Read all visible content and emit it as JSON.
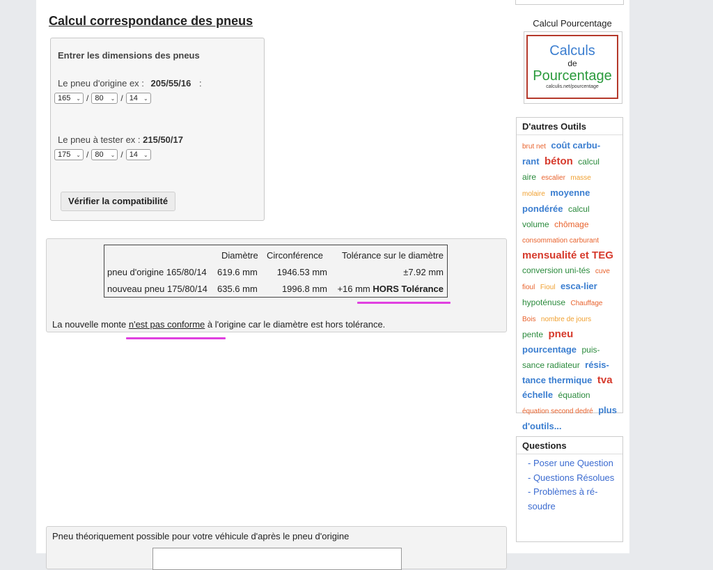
{
  "main": {
    "title": "Calcul correspondance des pneus",
    "form": {
      "heading": "Entrer les dimensions des pneus",
      "origin_label": "Le pneu d'origine ex : ",
      "origin_example": "205/55/16",
      "origin_suffix": ":",
      "origin_width": "165",
      "origin_ratio": "80",
      "origin_rim": "14",
      "test_label": "Le pneu à tester ex : ",
      "test_example": "215/50/17",
      "test_width": "175",
      "test_ratio": "80",
      "test_rim": "14",
      "separator": "/",
      "submit_label": "Vérifier la compatibilité"
    },
    "result": {
      "headers": [
        "Diamètre",
        "Circonférence",
        "Tolérance sur le diamètre"
      ],
      "rows": [
        {
          "label": "pneu d'origine 165/80/14",
          "diameter": "619.6 mm",
          "circumference": "1946.53 mm",
          "tolerance": "±7.92 mm",
          "tolerance_bold": ""
        },
        {
          "label": "nouveau pneu 175/80/14",
          "diameter": "635.6 mm",
          "circumference": "1996.8 mm",
          "tolerance": "+16 mm ",
          "tolerance_bold": "HORS Tolérance"
        }
      ],
      "verdict_before": "La nouvelle monte ",
      "verdict_link": "n'est pas conforme",
      "verdict_after": " à l'origine car le diamètre est hors tolérance."
    },
    "theoretical": {
      "text": "Pneu théoriquement possible pour votre véhicule d'après le pneu d'origine"
    }
  },
  "sidebar": {
    "percent_title": "Calcul Pourcentage",
    "percent_logo": {
      "line1": "Calculs",
      "line2": "de",
      "line3": "Pourcentage",
      "line4": "calculis.net/pourcentage"
    },
    "tools_title": "D'autres Outils",
    "tools": [
      {
        "label": "brut net",
        "color": "#e8622c",
        "size": "s"
      },
      {
        "label": "coût carbu-rant",
        "color": "#3b7ed0",
        "size": "l"
      },
      {
        "label": "béton",
        "color": "#d63a2c",
        "size": "xl"
      },
      {
        "label": "calcul aire",
        "color": "#2a8a3c",
        "size": "m"
      },
      {
        "label": "escalier",
        "color": "#e8622c",
        "size": "s"
      },
      {
        "label": "masse molaire",
        "color": "#f0a030",
        "size": "s"
      },
      {
        "label": "moyenne pondérée",
        "color": "#3b7ed0",
        "size": "l"
      },
      {
        "label": "calcul volume",
        "color": "#2a8a3c",
        "size": "m"
      },
      {
        "label": "chômage",
        "color": "#e8622c",
        "size": "m"
      },
      {
        "label": "consommation carburant",
        "color": "#e8622c",
        "size": "s"
      },
      {
        "label": "mensualité et TEG",
        "color": "#d63a2c",
        "size": "xl"
      },
      {
        "label": "conversion uni-tés",
        "color": "#2a8a3c",
        "size": "m"
      },
      {
        "label": "cuve fioul",
        "color": "#e8622c",
        "size": "s"
      },
      {
        "label": "Fioul",
        "color": "#f0a030",
        "size": "s"
      },
      {
        "label": "esca-lier",
        "color": "#3b7ed0",
        "size": "l"
      },
      {
        "label": "hypoténuse",
        "color": "#2a8a3c",
        "size": "m"
      },
      {
        "label": "Chauffage Bois",
        "color": "#e8622c",
        "size": "s"
      },
      {
        "label": "nombre de jours",
        "color": "#f0a030",
        "size": "s"
      },
      {
        "label": "pente",
        "color": "#2a8a3c",
        "size": "m"
      },
      {
        "label": "pneu",
        "color": "#d63a2c",
        "size": "xl"
      },
      {
        "label": "pourcentage",
        "color": "#3b7ed0",
        "size": "l"
      },
      {
        "label": "puis-sance radiateur",
        "color": "#2a8a3c",
        "size": "m"
      },
      {
        "label": "résis-tance thermique",
        "color": "#3b7ed0",
        "size": "l"
      },
      {
        "label": "tva",
        "color": "#d63a2c",
        "size": "xl"
      },
      {
        "label": "échelle",
        "color": "#3b7ed0",
        "size": "l"
      },
      {
        "label": "équation",
        "color": "#2a8a3c",
        "size": "m"
      },
      {
        "label": "équation second dedré",
        "color": "#e8622c",
        "size": "s"
      },
      {
        "label": "plus d'outils...",
        "color": "#3b7ed0",
        "size": "l"
      }
    ],
    "questions_title": "Questions",
    "questions": [
      "- Poser une Question",
      "- Questions Résolues",
      "- Problèmes à ré-soudre"
    ]
  }
}
